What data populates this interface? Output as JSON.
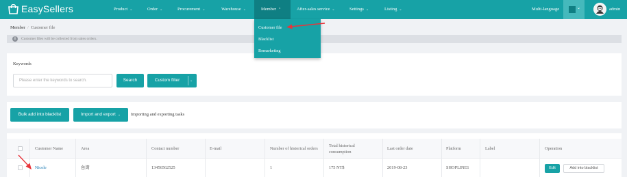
{
  "app": {
    "name": "EasySellers"
  },
  "nav": {
    "items": [
      {
        "label": "Product",
        "active": false
      },
      {
        "label": "Order",
        "active": false
      },
      {
        "label": "Procurement",
        "active": false
      },
      {
        "label": "Warehouse",
        "active": false
      },
      {
        "label": "Member",
        "active": true
      },
      {
        "label": "After-sales service",
        "active": false
      },
      {
        "label": "Settings",
        "active": false
      },
      {
        "label": "Listing",
        "active": false
      }
    ],
    "multi_language": "Multi-language",
    "user": "admin",
    "member_menu": [
      "Customer file",
      "Blacklist",
      "Remarketing"
    ]
  },
  "breadcrumb": {
    "parent": "Member",
    "separator": "/",
    "current": "Customer file"
  },
  "info": {
    "text": "Customer files will be collected from sales orders."
  },
  "search": {
    "label": "Keywords",
    "placeholder": "Please enter the keywords to search.",
    "search_button": "Search",
    "custom_filter": "Custom filter"
  },
  "actions": {
    "bulk_blacklist": "Bulk add into blacklist",
    "import_export": "Import and export",
    "import_export_tasks": "Importing and exporting tasks"
  },
  "table": {
    "columns": [
      "Customer Name",
      "Area",
      "Contact number",
      "E-mail",
      "Number of historical orders",
      "Total historical consumption",
      "Last order date",
      "Platform",
      "Label",
      "Operation"
    ],
    "rows": [
      {
        "name": "Nicole",
        "area": "台湾",
        "contact": "13456562525",
        "email": "",
        "orders": "1",
        "consumption": "175 NT$",
        "last_order": "2019-08-23",
        "platform": "SHOPLINE1",
        "label": "",
        "edit": "Edit",
        "add_blacklist": "Add into blacklist"
      }
    ]
  },
  "colors": {
    "brand": "#17a2a6",
    "brand_dark": "#0f7f83",
    "annotation": "#e8343a",
    "link": "#1677b3"
  }
}
